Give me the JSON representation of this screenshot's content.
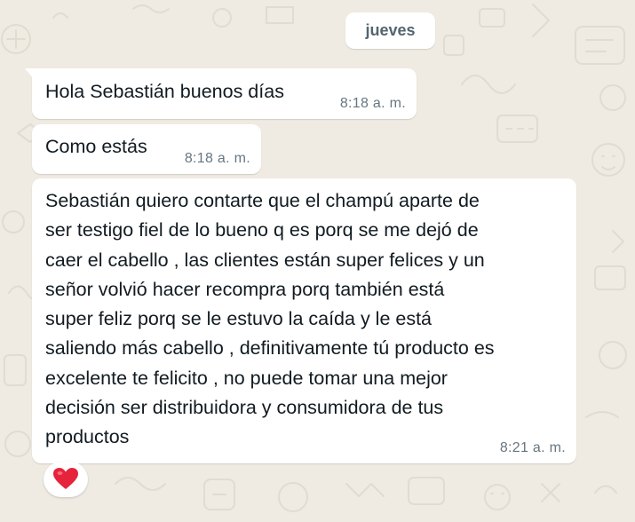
{
  "chat": {
    "date_divider": "jueves",
    "messages": [
      {
        "text": "Hola Sebastián buenos días",
        "time": "8:18 a. m."
      },
      {
        "text": "Como estás",
        "time": "8:18 a. m."
      },
      {
        "text": "Sebastián quiero contarte que el champú aparte de\nser testigo fiel de lo bueno q es porq se me dejó de\ncaer el cabello , las clientes están super felices y un\nseñor volvió hacer recompra porq también está\nsuper feliz porq se le estuvo la caída y le está\nsaliendo más cabello , definitivamente tú producto es\nexcelente te felicito , no puede tomar una mejor\ndecisión ser distribuidora y consumidora de tus\nproductos",
        "time": "8:21 a. m.",
        "reaction": "heart-icon"
      }
    ]
  },
  "colors": {
    "wallpaper": "#efeae2",
    "bubble": "#ffffff",
    "timestamp": "#667781",
    "heart": "#e5243b"
  }
}
